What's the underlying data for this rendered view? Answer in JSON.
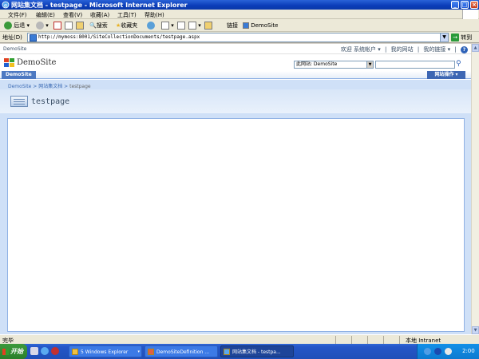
{
  "window": {
    "title": "网站集文档 - testpage - Microsoft Internet Explorer",
    "buttons": [
      "_",
      "□",
      "×"
    ]
  },
  "menu": {
    "items": [
      "文件(F)",
      "编辑(E)",
      "查看(V)",
      "收藏(A)",
      "工具(T)",
      "帮助(H)"
    ]
  },
  "toolbar": {
    "back_label": "后退",
    "search_label": "搜索",
    "favorites_label": "收藏夹",
    "links_label": "链接",
    "link_demosite": "DemoSite"
  },
  "address": {
    "label": "地址(D)",
    "url": "http://mymoss:8001/SiteCollectionDocuments/testpage.aspx",
    "go_label": "转到"
  },
  "sharepoint": {
    "top_site": "DemoSite",
    "welcome_text": "欢迎 系统帐户 ▾",
    "my_site": "我的网站",
    "my_links": "我的链接 ▾",
    "help_glyph": "?",
    "site_name": "DemoSite",
    "search_scope": "此网站: DemoSite",
    "nav_tab": "DemoSite",
    "site_actions": "网站操作 ▾",
    "breadcrumb": {
      "root": "DemoSite",
      "library": "网站集文档",
      "current": "testpage"
    },
    "page_title": "testpage"
  },
  "status": {
    "text": "完毕",
    "zone": "本地 Intranet"
  },
  "taskbar": {
    "start_label": "开始",
    "tasks": [
      {
        "label": "5 Windows Explorer"
      },
      {
        "label": "DemoSiteDefinition ..."
      },
      {
        "label": "网站集文档 - testpa..."
      }
    ],
    "clock": "2:00"
  }
}
